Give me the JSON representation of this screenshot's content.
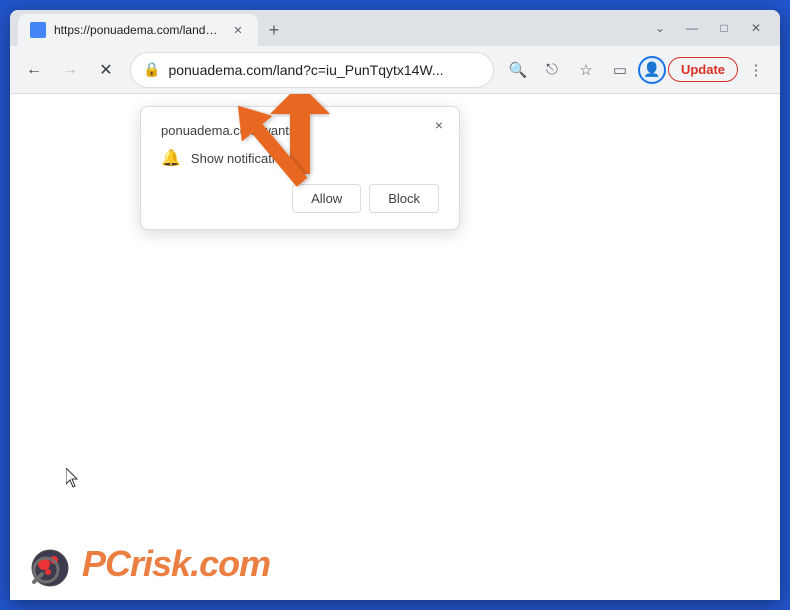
{
  "browser": {
    "tab": {
      "title": "https://ponuadema.com/land?c= ×",
      "url": "ponuadema.com/land?c=iu_PunTqytx14W...",
      "new_tab_label": "+"
    },
    "window_controls": {
      "chevron_label": "⌄",
      "minimize_label": "—",
      "maximize_label": "□",
      "close_label": "✕"
    },
    "nav": {
      "back_label": "←",
      "forward_label": "→",
      "reload_label": "✕"
    },
    "toolbar": {
      "search_icon_label": "🔍",
      "share_icon_label": "⎋",
      "bookmark_icon_label": "☆",
      "split_icon_label": "▭",
      "profile_icon_label": "👤",
      "update_label": "Update",
      "menu_label": "⋮"
    }
  },
  "notification_popup": {
    "title": "ponuadema.com wants to",
    "permission_text": "Show notifications",
    "allow_label": "Allow",
    "block_label": "Block",
    "close_label": "×"
  },
  "watermark": {
    "brand": "PC",
    "suffix": "risk.com"
  },
  "colors": {
    "arrow_orange": "#e86820",
    "update_red": "#d93025",
    "accent_blue": "#1a73e8"
  }
}
